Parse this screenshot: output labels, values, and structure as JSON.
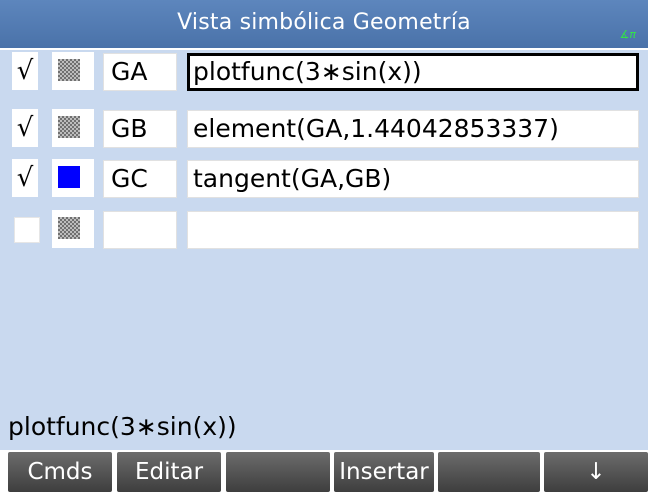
{
  "title": "Vista simbólica Geometría",
  "mode_indicator": "∡π",
  "rows": [
    {
      "checked": true,
      "check_glyph": "√",
      "swatch": "pattern",
      "name": "GA",
      "expr": "plotfunc(3∗sin(x))",
      "selected": true
    },
    {
      "checked": true,
      "check_glyph": "√",
      "swatch": "pattern",
      "name": "GB",
      "expr": "element(GA,1.44042853337)",
      "selected": false
    },
    {
      "checked": true,
      "check_glyph": "√",
      "swatch": "blue",
      "name": "GC",
      "expr": "tangent(GA,GB)",
      "selected": false
    },
    {
      "checked": false,
      "check_glyph": "",
      "swatch": "pattern",
      "name": "",
      "expr": "",
      "selected": false
    }
  ],
  "command_line": "plotfunc(3∗sin(x))",
  "softkeys": [
    "Cmds",
    "Editar",
    "",
    "Insertar",
    "",
    "↓"
  ],
  "colors": {
    "title_bar": "#4a72a9",
    "selected_row": "#c9d9ef",
    "swatch_blue": "#0000ff",
    "check_on": "#000000"
  }
}
